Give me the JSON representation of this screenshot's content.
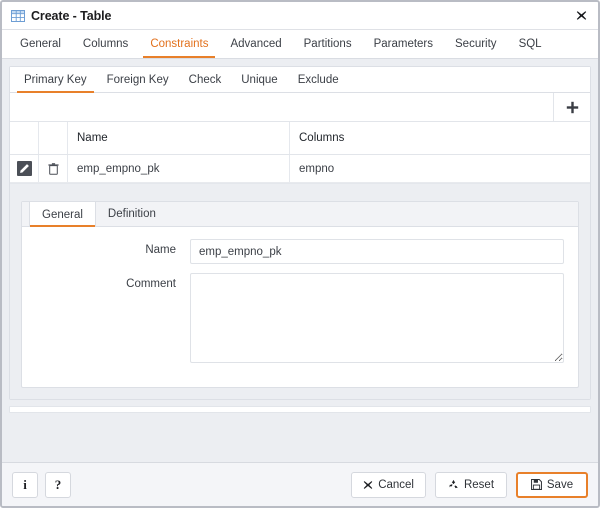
{
  "window": {
    "title": "Create - Table",
    "title_icon": "table-grid-icon",
    "close_icon": "close-icon"
  },
  "main_tabs": [
    {
      "label": "General",
      "active": false
    },
    {
      "label": "Columns",
      "active": false
    },
    {
      "label": "Constraints",
      "active": true
    },
    {
      "label": "Advanced",
      "active": false
    },
    {
      "label": "Partitions",
      "active": false
    },
    {
      "label": "Parameters",
      "active": false
    },
    {
      "label": "Security",
      "active": false
    },
    {
      "label": "SQL",
      "active": false
    }
  ],
  "sub_tabs": [
    {
      "label": "Primary Key",
      "active": true
    },
    {
      "label": "Foreign Key",
      "active": false
    },
    {
      "label": "Check",
      "active": false
    },
    {
      "label": "Unique",
      "active": false
    },
    {
      "label": "Exclude",
      "active": false
    }
  ],
  "grid": {
    "add_label": "+",
    "columns": [
      "Name",
      "Columns"
    ],
    "rows": [
      {
        "name": "emp_empno_pk",
        "columns": "empno",
        "edit_icon": "edit-pencil-icon",
        "delete_icon": "trash-icon"
      }
    ]
  },
  "detail": {
    "tabs": [
      {
        "label": "General",
        "active": true
      },
      {
        "label": "Definition",
        "active": false
      }
    ],
    "fields": {
      "name_label": "Name",
      "name_value": "emp_empno_pk",
      "name_placeholder": "",
      "comment_label": "Comment",
      "comment_value": "",
      "comment_placeholder": ""
    }
  },
  "footer": {
    "info_label": "i",
    "help_label": "?",
    "cancel_label": "Cancel",
    "reset_label": "Reset",
    "save_label": "Save"
  },
  "colors": {
    "accent": "#e8802a",
    "window_bg": "#eceef2",
    "panel_bg": "#ffffff",
    "text": "#3b3f46",
    "icon_blue": "#7aa7d9"
  }
}
